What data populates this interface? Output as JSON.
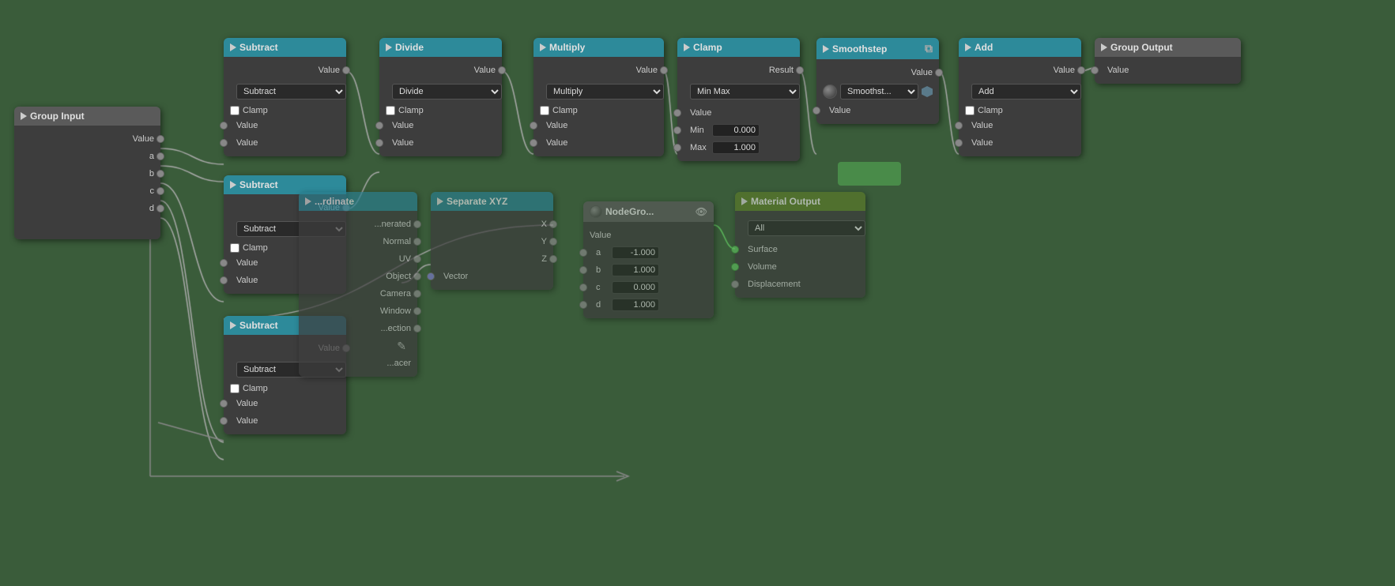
{
  "canvas": {
    "bg_color": "#3a5c3a"
  },
  "nodes": {
    "group_input": {
      "title": "Group Input",
      "outputs": [
        "Value",
        "a",
        "b",
        "c",
        "d"
      ]
    },
    "group_output": {
      "title": "Group Output",
      "inputs": [
        "Value"
      ]
    },
    "subtract_1": {
      "title": "Subtract",
      "operation": "Subtract",
      "outputs": [
        "Value"
      ],
      "inputs": [
        "Value",
        "Value"
      ]
    },
    "subtract_2": {
      "title": "Subtract",
      "operation": "Subtract",
      "outputs": [
        "Value"
      ],
      "inputs": [
        "Value",
        "Value"
      ]
    },
    "subtract_3": {
      "title": "Subtract",
      "operation": "Subtract",
      "outputs": [
        "Value"
      ],
      "inputs": [
        "Value",
        "Value"
      ]
    },
    "divide": {
      "title": "Divide",
      "operation": "Divide",
      "outputs": [
        "Value"
      ],
      "inputs": [
        "Value",
        "Value"
      ]
    },
    "multiply": {
      "title": "Multiply",
      "operation": "Multiply",
      "outputs": [
        "Value"
      ],
      "inputs": [
        "Value",
        "Value"
      ]
    },
    "clamp": {
      "title": "Clamp",
      "mode": "Min Max",
      "outputs": [
        "Result"
      ],
      "inputs": [
        "Value",
        "Min",
        "Max"
      ],
      "min_val": "0.000",
      "max_val": "1.000"
    },
    "smoothstep": {
      "title": "Smoothstep",
      "outputs": [
        "Value"
      ],
      "inputs": [
        "Value"
      ]
    },
    "add": {
      "title": "Add",
      "operation": "Add",
      "outputs": [
        "Value"
      ],
      "inputs": [
        "Value",
        "Value"
      ]
    },
    "coordinate": {
      "title": "Texture Coordinate",
      "outputs": [
        "Generated",
        "Normal",
        "UV",
        "Object",
        "Camera",
        "Window",
        "Reflection",
        ""
      ]
    },
    "separate_xyz": {
      "title": "Separate XYZ",
      "outputs": [
        "X",
        "Y",
        "Z"
      ],
      "inputs": [
        "Vector"
      ]
    },
    "nodegroup": {
      "title": "NodeGroup",
      "outputs": [
        "Value",
        "a",
        "b",
        "c",
        "d"
      ],
      "inputs": [],
      "values": {
        "a": "-1.000",
        "b": "1.000",
        "c": "0.000",
        "d": "1.000"
      }
    },
    "material_output": {
      "title": "Material Output",
      "target": "All",
      "inputs": [
        "Surface",
        "Volume",
        "Displacement"
      ]
    }
  },
  "labels": {
    "clamp": "Clamp",
    "value": "Value",
    "normal": "Normal"
  }
}
